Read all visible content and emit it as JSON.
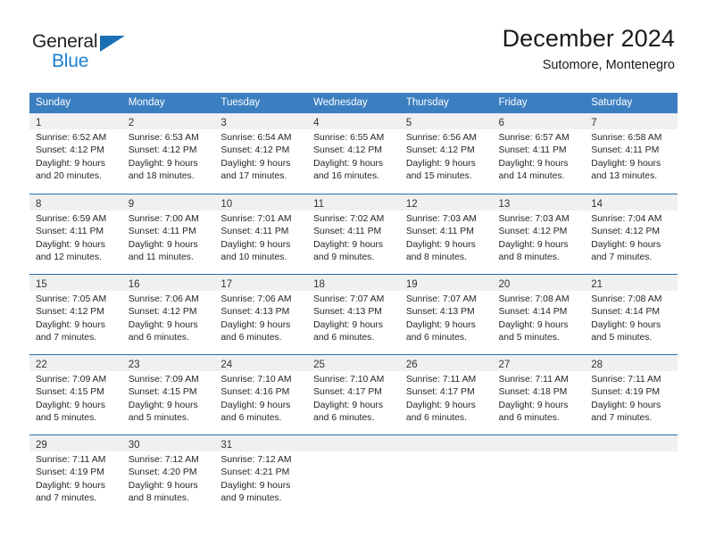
{
  "brand": {
    "name_part1": "General",
    "name_part2": "Blue",
    "color_dark": "#231f20",
    "color_blue": "#1b7fd1",
    "triangle_icon": "triangle-icon"
  },
  "header": {
    "title": "December 2024",
    "subtitle": "Sutomore, Montenegro"
  },
  "calendar": {
    "header_bg": "#3c7fc1",
    "header_text_color": "#ffffff",
    "daynum_band_bg": "#f0f0f0",
    "row_divider_color": "#2a6ead",
    "weekdays": [
      "Sunday",
      "Monday",
      "Tuesday",
      "Wednesday",
      "Thursday",
      "Friday",
      "Saturday"
    ],
    "weeks": [
      [
        {
          "day": "1",
          "sunrise": "Sunrise: 6:52 AM",
          "sunset": "Sunset: 4:12 PM",
          "daylight_line1": "Daylight: 9 hours",
          "daylight_line2": "and 20 minutes."
        },
        {
          "day": "2",
          "sunrise": "Sunrise: 6:53 AM",
          "sunset": "Sunset: 4:12 PM",
          "daylight_line1": "Daylight: 9 hours",
          "daylight_line2": "and 18 minutes."
        },
        {
          "day": "3",
          "sunrise": "Sunrise: 6:54 AM",
          "sunset": "Sunset: 4:12 PM",
          "daylight_line1": "Daylight: 9 hours",
          "daylight_line2": "and 17 minutes."
        },
        {
          "day": "4",
          "sunrise": "Sunrise: 6:55 AM",
          "sunset": "Sunset: 4:12 PM",
          "daylight_line1": "Daylight: 9 hours",
          "daylight_line2": "and 16 minutes."
        },
        {
          "day": "5",
          "sunrise": "Sunrise: 6:56 AM",
          "sunset": "Sunset: 4:12 PM",
          "daylight_line1": "Daylight: 9 hours",
          "daylight_line2": "and 15 minutes."
        },
        {
          "day": "6",
          "sunrise": "Sunrise: 6:57 AM",
          "sunset": "Sunset: 4:11 PM",
          "daylight_line1": "Daylight: 9 hours",
          "daylight_line2": "and 14 minutes."
        },
        {
          "day": "7",
          "sunrise": "Sunrise: 6:58 AM",
          "sunset": "Sunset: 4:11 PM",
          "daylight_line1": "Daylight: 9 hours",
          "daylight_line2": "and 13 minutes."
        }
      ],
      [
        {
          "day": "8",
          "sunrise": "Sunrise: 6:59 AM",
          "sunset": "Sunset: 4:11 PM",
          "daylight_line1": "Daylight: 9 hours",
          "daylight_line2": "and 12 minutes."
        },
        {
          "day": "9",
          "sunrise": "Sunrise: 7:00 AM",
          "sunset": "Sunset: 4:11 PM",
          "daylight_line1": "Daylight: 9 hours",
          "daylight_line2": "and 11 minutes."
        },
        {
          "day": "10",
          "sunrise": "Sunrise: 7:01 AM",
          "sunset": "Sunset: 4:11 PM",
          "daylight_line1": "Daylight: 9 hours",
          "daylight_line2": "and 10 minutes."
        },
        {
          "day": "11",
          "sunrise": "Sunrise: 7:02 AM",
          "sunset": "Sunset: 4:11 PM",
          "daylight_line1": "Daylight: 9 hours",
          "daylight_line2": "and 9 minutes."
        },
        {
          "day": "12",
          "sunrise": "Sunrise: 7:03 AM",
          "sunset": "Sunset: 4:11 PM",
          "daylight_line1": "Daylight: 9 hours",
          "daylight_line2": "and 8 minutes."
        },
        {
          "day": "13",
          "sunrise": "Sunrise: 7:03 AM",
          "sunset": "Sunset: 4:12 PM",
          "daylight_line1": "Daylight: 9 hours",
          "daylight_line2": "and 8 minutes."
        },
        {
          "day": "14",
          "sunrise": "Sunrise: 7:04 AM",
          "sunset": "Sunset: 4:12 PM",
          "daylight_line1": "Daylight: 9 hours",
          "daylight_line2": "and 7 minutes."
        }
      ],
      [
        {
          "day": "15",
          "sunrise": "Sunrise: 7:05 AM",
          "sunset": "Sunset: 4:12 PM",
          "daylight_line1": "Daylight: 9 hours",
          "daylight_line2": "and 7 minutes."
        },
        {
          "day": "16",
          "sunrise": "Sunrise: 7:06 AM",
          "sunset": "Sunset: 4:12 PM",
          "daylight_line1": "Daylight: 9 hours",
          "daylight_line2": "and 6 minutes."
        },
        {
          "day": "17",
          "sunrise": "Sunrise: 7:06 AM",
          "sunset": "Sunset: 4:13 PM",
          "daylight_line1": "Daylight: 9 hours",
          "daylight_line2": "and 6 minutes."
        },
        {
          "day": "18",
          "sunrise": "Sunrise: 7:07 AM",
          "sunset": "Sunset: 4:13 PM",
          "daylight_line1": "Daylight: 9 hours",
          "daylight_line2": "and 6 minutes."
        },
        {
          "day": "19",
          "sunrise": "Sunrise: 7:07 AM",
          "sunset": "Sunset: 4:13 PM",
          "daylight_line1": "Daylight: 9 hours",
          "daylight_line2": "and 6 minutes."
        },
        {
          "day": "20",
          "sunrise": "Sunrise: 7:08 AM",
          "sunset": "Sunset: 4:14 PM",
          "daylight_line1": "Daylight: 9 hours",
          "daylight_line2": "and 5 minutes."
        },
        {
          "day": "21",
          "sunrise": "Sunrise: 7:08 AM",
          "sunset": "Sunset: 4:14 PM",
          "daylight_line1": "Daylight: 9 hours",
          "daylight_line2": "and 5 minutes."
        }
      ],
      [
        {
          "day": "22",
          "sunrise": "Sunrise: 7:09 AM",
          "sunset": "Sunset: 4:15 PM",
          "daylight_line1": "Daylight: 9 hours",
          "daylight_line2": "and 5 minutes."
        },
        {
          "day": "23",
          "sunrise": "Sunrise: 7:09 AM",
          "sunset": "Sunset: 4:15 PM",
          "daylight_line1": "Daylight: 9 hours",
          "daylight_line2": "and 5 minutes."
        },
        {
          "day": "24",
          "sunrise": "Sunrise: 7:10 AM",
          "sunset": "Sunset: 4:16 PM",
          "daylight_line1": "Daylight: 9 hours",
          "daylight_line2": "and 6 minutes."
        },
        {
          "day": "25",
          "sunrise": "Sunrise: 7:10 AM",
          "sunset": "Sunset: 4:17 PM",
          "daylight_line1": "Daylight: 9 hours",
          "daylight_line2": "and 6 minutes."
        },
        {
          "day": "26",
          "sunrise": "Sunrise: 7:11 AM",
          "sunset": "Sunset: 4:17 PM",
          "daylight_line1": "Daylight: 9 hours",
          "daylight_line2": "and 6 minutes."
        },
        {
          "day": "27",
          "sunrise": "Sunrise: 7:11 AM",
          "sunset": "Sunset: 4:18 PM",
          "daylight_line1": "Daylight: 9 hours",
          "daylight_line2": "and 6 minutes."
        },
        {
          "day": "28",
          "sunrise": "Sunrise: 7:11 AM",
          "sunset": "Sunset: 4:19 PM",
          "daylight_line1": "Daylight: 9 hours",
          "daylight_line2": "and 7 minutes."
        }
      ],
      [
        {
          "day": "29",
          "sunrise": "Sunrise: 7:11 AM",
          "sunset": "Sunset: 4:19 PM",
          "daylight_line1": "Daylight: 9 hours",
          "daylight_line2": "and 7 minutes."
        },
        {
          "day": "30",
          "sunrise": "Sunrise: 7:12 AM",
          "sunset": "Sunset: 4:20 PM",
          "daylight_line1": "Daylight: 9 hours",
          "daylight_line2": "and 8 minutes."
        },
        {
          "day": "31",
          "sunrise": "Sunrise: 7:12 AM",
          "sunset": "Sunset: 4:21 PM",
          "daylight_line1": "Daylight: 9 hours",
          "daylight_line2": "and 9 minutes."
        },
        {
          "day": "",
          "sunrise": "",
          "sunset": "",
          "daylight_line1": "",
          "daylight_line2": ""
        },
        {
          "day": "",
          "sunrise": "",
          "sunset": "",
          "daylight_line1": "",
          "daylight_line2": ""
        },
        {
          "day": "",
          "sunrise": "",
          "sunset": "",
          "daylight_line1": "",
          "daylight_line2": ""
        },
        {
          "day": "",
          "sunrise": "",
          "sunset": "",
          "daylight_line1": "",
          "daylight_line2": ""
        }
      ]
    ]
  }
}
